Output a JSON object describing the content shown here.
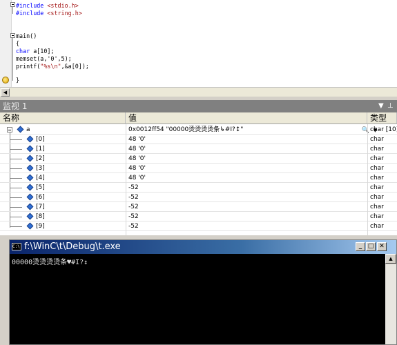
{
  "editor": {
    "lines": [
      {
        "pre": "#include ",
        "str": "<stdio.h>"
      },
      {
        "pre": "#include ",
        "str": "<string.h>"
      },
      {
        "plain": "main()"
      },
      {
        "plain": "{"
      },
      {
        "kw": "char",
        "rest": " a[10];"
      },
      {
        "plain": "memset(a,'0',5);"
      },
      {
        "printf_pre": "printf(",
        "printf_str": "\"%s\\n\"",
        "printf_post": ",&a[0]);"
      },
      {
        "plain": "}"
      }
    ]
  },
  "watch": {
    "title": "监视 1",
    "columns": {
      "name": "名称",
      "value": "值",
      "type": "类型"
    },
    "root": {
      "name": "a",
      "value": "0x0012ff54 \"00000烫烫烫烫条↳#I?↕\"",
      "type": "char [10]"
    },
    "rows": [
      {
        "name": "[0]",
        "value": "48 '0'",
        "type": "char"
      },
      {
        "name": "[1]",
        "value": "48 '0'",
        "type": "char"
      },
      {
        "name": "[2]",
        "value": "48 '0'",
        "type": "char"
      },
      {
        "name": "[3]",
        "value": "48 '0'",
        "type": "char"
      },
      {
        "name": "[4]",
        "value": "48 '0'",
        "type": "char"
      },
      {
        "name": "[5]",
        "value": "-52",
        "type": "char"
      },
      {
        "name": "[6]",
        "value": "-52",
        "type": "char"
      },
      {
        "name": "[7]",
        "value": "-52",
        "type": "char"
      },
      {
        "name": "[8]",
        "value": "-52",
        "type": "char"
      },
      {
        "name": "[9]",
        "value": "-52",
        "type": "char"
      }
    ]
  },
  "console": {
    "title": "f:\\WinC\\t\\Debug\\t.exe",
    "output": "00000烫烫烫烫条♥#I?↕",
    "icon_text": "C:\\"
  }
}
